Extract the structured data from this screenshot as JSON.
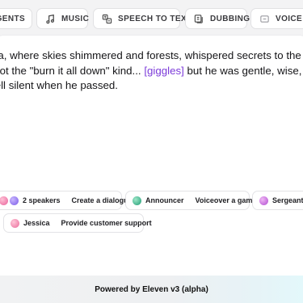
{
  "tabs": [
    {
      "label": "AGENTS",
      "icon": "agents-icon"
    },
    {
      "label": "MUSIC",
      "icon": "music-note-icon"
    },
    {
      "label": "SPEECH TO TEXT",
      "icon": "speech-to-text-icon"
    },
    {
      "label": "DUBBING",
      "icon": "dubbing-icon"
    },
    {
      "label": "VOICE CL",
      "icon": "voice-clone-icon"
    }
  ],
  "story": {
    "line1": "ria, where skies shimmered and forests, whispered secrets to the win",
    "line2_a": "Not the \"burn it all down\" kind... ",
    "line2_tag": "[giggles]",
    "line2_b": " but he was gentle, wise, with",
    "line3": "fell silent when he passed."
  },
  "chips": [
    {
      "speaker": "2 speakers",
      "action": "Create a dialogue"
    },
    {
      "speaker": "Announcer",
      "action": "Voiceover a game"
    },
    {
      "speaker": "Sergeant",
      "action": ""
    },
    {
      "speaker": "Jessica",
      "action": "Provide customer support"
    }
  ],
  "footer": {
    "text": "Powered by Eleven v3 (alpha)"
  },
  "colors": {
    "accent_tag": "#7c3bd9",
    "footer_tint": "#e3f8fb"
  }
}
